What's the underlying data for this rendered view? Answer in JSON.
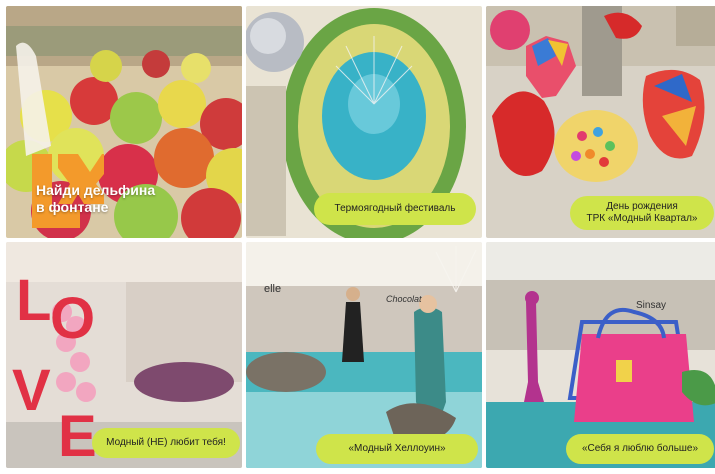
{
  "tiles": [
    {
      "caption_line1": "Найди дельфина",
      "caption_line2": "в фонтане",
      "logo": "lx-logo"
    },
    {
      "caption": "Термоягодный фестиваль"
    },
    {
      "caption_line1": "День рождения",
      "caption_line2": "ТРК «Модный Квартал»"
    },
    {
      "caption": "Модный (НЕ) любит тебя!",
      "sign": "LOVE"
    },
    {
      "caption": "«Модный Хеллоуин»",
      "sign1": "elle",
      "sign2": "Chocolat"
    },
    {
      "caption": "«Себя я люблю больше»",
      "sign": "Sinsay"
    }
  ],
  "colors": {
    "caption_bg": "#cfe44a",
    "accent": "#f39a2b"
  }
}
